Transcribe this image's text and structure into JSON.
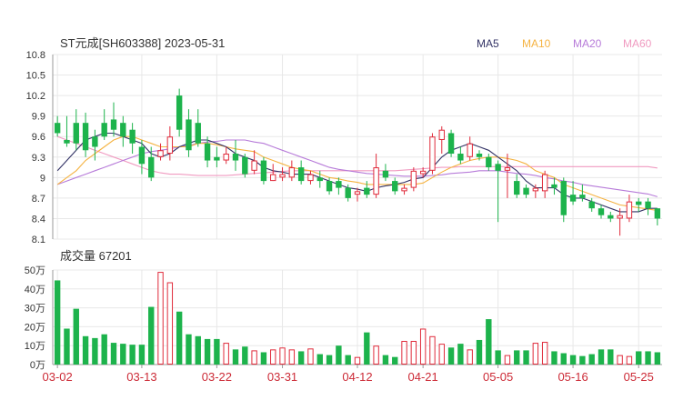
{
  "chart_data": [
    {
      "type": "candlestick",
      "title": "ST元成[SH603388] 2023-05-31",
      "ylim": [
        8.1,
        10.8
      ],
      "yticks": [
        "10.8",
        "10.5",
        "10.2",
        "9.9",
        "9.6",
        "9.3",
        "9",
        "8.7",
        "8.4",
        "8.1"
      ],
      "ytick_values": [
        10.8,
        10.5,
        10.2,
        9.9,
        9.6,
        9.3,
        9.0,
        8.7,
        8.4,
        8.1
      ],
      "legend": [
        {
          "name": "MA5",
          "color": "#333366"
        },
        {
          "name": "MA10",
          "color": "#f5b342"
        },
        {
          "name": "MA20",
          "color": "#b77bd9"
        },
        {
          "name": "MA60",
          "color": "#f09ac0"
        }
      ],
      "up_color": "#e02b3b",
      "down_color": "#1db34c",
      "candles": [
        [
          9.8,
          9.65,
          9.9,
          9.6
        ],
        [
          9.55,
          9.5,
          9.9,
          9.45
        ],
        [
          9.8,
          9.5,
          10.0,
          9.4
        ],
        [
          9.8,
          9.4,
          9.95,
          9.3
        ],
        [
          9.6,
          9.45,
          9.7,
          9.25
        ],
        [
          9.8,
          9.6,
          10.0,
          9.55
        ],
        [
          9.85,
          9.7,
          10.1,
          9.6
        ],
        [
          9.8,
          9.6,
          9.9,
          9.45
        ],
        [
          9.7,
          9.5,
          9.8,
          9.35
        ],
        [
          9.45,
          9.2,
          9.55,
          9.05
        ],
        [
          9.3,
          9.0,
          9.45,
          8.95
        ],
        [
          9.3,
          9.4,
          9.5,
          9.25
        ],
        [
          9.35,
          9.6,
          9.75,
          9.25
        ],
        [
          10.2,
          9.7,
          10.3,
          9.6
        ],
        [
          9.85,
          9.4,
          10.0,
          9.3
        ],
        [
          9.8,
          9.5,
          10.0,
          9.45
        ],
        [
          9.5,
          9.25,
          9.6,
          9.15
        ],
        [
          9.3,
          9.25,
          9.45,
          9.15
        ],
        [
          9.25,
          9.35,
          9.45,
          9.2
        ],
        [
          9.35,
          9.25,
          9.55,
          9.1
        ],
        [
          9.3,
          9.05,
          9.35,
          9.0
        ],
        [
          9.1,
          9.25,
          9.4,
          9.05
        ],
        [
          9.25,
          8.95,
          9.3,
          8.9
        ],
        [
          8.95,
          9.05,
          9.2,
          8.95
        ],
        [
          9.0,
          9.05,
          9.15,
          8.95
        ],
        [
          9.0,
          9.15,
          9.25,
          8.95
        ],
        [
          9.15,
          8.95,
          9.25,
          8.9
        ],
        [
          8.95,
          9.05,
          9.1,
          8.9
        ],
        [
          9.0,
          8.95,
          9.1,
          8.85
        ],
        [
          8.95,
          8.8,
          9.0,
          8.75
        ],
        [
          8.95,
          8.85,
          9.0,
          8.75
        ],
        [
          8.85,
          8.7,
          8.9,
          8.65
        ],
        [
          8.75,
          8.8,
          8.85,
          8.65
        ],
        [
          8.85,
          8.75,
          8.95,
          8.7
        ],
        [
          8.75,
          9.15,
          9.35,
          8.7
        ],
        [
          9.1,
          9.0,
          9.2,
          8.95
        ],
        [
          8.95,
          8.8,
          9.0,
          8.75
        ],
        [
          8.8,
          8.85,
          8.9,
          8.75
        ],
        [
          8.85,
          9.1,
          9.15,
          8.8
        ],
        [
          9.05,
          9.1,
          9.15,
          9.0
        ],
        [
          9.1,
          9.6,
          9.65,
          9.05
        ],
        [
          9.55,
          9.7,
          9.75,
          9.35
        ],
        [
          9.65,
          9.35,
          9.7,
          9.3
        ],
        [
          9.35,
          9.25,
          9.45,
          9.2
        ],
        [
          9.3,
          9.5,
          9.6,
          9.25
        ],
        [
          9.35,
          9.3,
          9.4,
          9.25
        ],
        [
          9.3,
          9.15,
          9.35,
          9.1
        ],
        [
          9.2,
          9.1,
          9.25,
          8.35
        ],
        [
          9.1,
          9.15,
          9.35,
          8.7
        ],
        [
          8.95,
          8.75,
          9.05,
          8.7
        ],
        [
          8.85,
          8.75,
          8.9,
          8.7
        ],
        [
          8.8,
          8.85,
          8.9,
          8.7
        ],
        [
          8.8,
          9.05,
          9.1,
          8.7
        ],
        [
          8.9,
          8.85,
          9.0,
          8.75
        ],
        [
          8.95,
          8.45,
          9.0,
          8.35
        ],
        [
          8.75,
          8.65,
          8.95,
          8.6
        ],
        [
          8.75,
          8.7,
          8.9,
          8.65
        ],
        [
          8.65,
          8.55,
          8.7,
          8.5
        ],
        [
          8.55,
          8.45,
          8.6,
          8.4
        ],
        [
          8.45,
          8.4,
          8.5,
          8.35
        ],
        [
          8.4,
          8.45,
          8.55,
          8.15
        ],
        [
          8.4,
          8.65,
          8.75,
          8.35
        ],
        [
          8.65,
          8.6,
          8.7,
          8.5
        ],
        [
          8.65,
          8.55,
          8.7,
          8.45
        ],
        [
          8.55,
          8.4,
          8.55,
          8.3
        ]
      ],
      "ma5": [
        9.1,
        9.25,
        9.4,
        9.55,
        9.6,
        9.65,
        9.65,
        9.6,
        9.55,
        9.5,
        9.35,
        9.3,
        9.35,
        9.45,
        9.5,
        9.55,
        9.55,
        9.5,
        9.45,
        9.35,
        9.3,
        9.25,
        9.15,
        9.1,
        9.08,
        9.05,
        9.05,
        9.05,
        9.0,
        8.95,
        8.9,
        8.85,
        8.83,
        8.8,
        8.85,
        8.88,
        8.9,
        8.93,
        8.98,
        9.0,
        9.15,
        9.3,
        9.4,
        9.45,
        9.5,
        9.45,
        9.4,
        9.3,
        9.2,
        9.1,
        8.95,
        8.85,
        8.85,
        8.85,
        8.75,
        8.7,
        8.7,
        8.65,
        8.6,
        8.55,
        8.5,
        8.5,
        8.5,
        8.55,
        8.55
      ],
      "ma10": [
        8.9,
        9.0,
        9.1,
        9.25,
        9.35,
        9.45,
        9.55,
        9.6,
        9.6,
        9.55,
        9.5,
        9.45,
        9.45,
        9.45,
        9.45,
        9.5,
        9.5,
        9.48,
        9.45,
        9.42,
        9.4,
        9.38,
        9.3,
        9.25,
        9.2,
        9.15,
        9.12,
        9.1,
        9.05,
        9.0,
        8.98,
        8.95,
        8.93,
        8.9,
        8.9,
        8.9,
        8.9,
        8.9,
        8.9,
        8.92,
        9.0,
        9.08,
        9.15,
        9.2,
        9.25,
        9.28,
        9.3,
        9.3,
        9.28,
        9.25,
        9.2,
        9.1,
        9.05,
        9.0,
        8.9,
        8.85,
        8.8,
        8.75,
        8.7,
        8.65,
        8.6,
        8.58,
        8.56,
        8.54,
        8.52
      ],
      "ma20": [
        8.9,
        8.95,
        9.0,
        9.05,
        9.1,
        9.15,
        9.2,
        9.25,
        9.3,
        9.35,
        9.38,
        9.4,
        9.42,
        9.45,
        9.47,
        9.5,
        9.52,
        9.53,
        9.55,
        9.55,
        9.55,
        9.52,
        9.5,
        9.45,
        9.4,
        9.35,
        9.3,
        9.25,
        9.2,
        9.15,
        9.12,
        9.1,
        9.08,
        9.06,
        9.05,
        9.04,
        9.03,
        9.02,
        9.02,
        9.02,
        9.03,
        9.04,
        9.06,
        9.07,
        9.08,
        9.1,
        9.1,
        9.1,
        9.08,
        9.06,
        9.05,
        9.03,
        9.0,
        8.98,
        8.95,
        8.93,
        8.9,
        8.88,
        8.86,
        8.84,
        8.82,
        8.8,
        8.78,
        8.76,
        8.72
      ],
      "ma60": [
        9.6,
        9.55,
        9.5,
        9.45,
        9.4,
        9.35,
        9.3,
        9.25,
        9.2,
        9.15,
        9.1,
        9.07,
        9.05,
        9.05,
        9.04,
        9.03,
        9.03,
        9.03,
        9.03,
        9.04,
        9.05,
        9.06,
        9.07,
        9.08,
        9.09,
        9.1,
        9.1,
        9.1,
        9.1,
        9.1,
        9.1,
        9.1,
        9.1,
        9.1,
        9.1,
        9.1,
        9.1,
        9.11,
        9.12,
        9.13,
        9.14,
        9.15,
        9.15,
        9.16,
        9.16,
        9.16,
        9.16,
        9.16,
        9.16,
        9.16,
        9.16,
        9.16,
        9.16,
        9.16,
        9.16,
        9.16,
        9.16,
        9.16,
        9.16,
        9.16,
        9.16,
        9.16,
        9.16,
        9.16,
        9.14
      ]
    },
    {
      "type": "bar",
      "title": "成交量 67201",
      "ylim": [
        0,
        50
      ],
      "yticks": [
        "50万",
        "40万",
        "30万",
        "20万",
        "10万",
        "0万"
      ],
      "ytick_values": [
        50,
        40,
        30,
        20,
        10,
        0
      ],
      "x_tick_labels": [
        {
          "index": 0,
          "label": "03-02"
        },
        {
          "index": 9,
          "label": "03-13"
        },
        {
          "index": 17,
          "label": "03-22"
        },
        {
          "index": 24,
          "label": "03-31"
        },
        {
          "index": 32,
          "label": "04-12"
        },
        {
          "index": 39,
          "label": "04-21"
        },
        {
          "index": 47,
          "label": "05-05"
        },
        {
          "index": 55,
          "label": "05-16"
        },
        {
          "index": 62,
          "label": "05-25"
        }
      ],
      "volumes": [
        44.5,
        19,
        29.5,
        15,
        14,
        16,
        11.5,
        11,
        10.5,
        10.5,
        30.5,
        49,
        43.5,
        28,
        16,
        15,
        13.5,
        13.5,
        11.5,
        8,
        9.5,
        7.5,
        6.5,
        8,
        9,
        8,
        7,
        8.5,
        5.5,
        5,
        10,
        5,
        4,
        17,
        10,
        5,
        4,
        12.5,
        12.5,
        19,
        15,
        11,
        9,
        11,
        8,
        13,
        24,
        7.5,
        5,
        7.5,
        7.5,
        11.5,
        12,
        7,
        6,
        5,
        4.5,
        5.5,
        8,
        8,
        5,
        4.5,
        7,
        7,
        6.5
      ]
    }
  ]
}
